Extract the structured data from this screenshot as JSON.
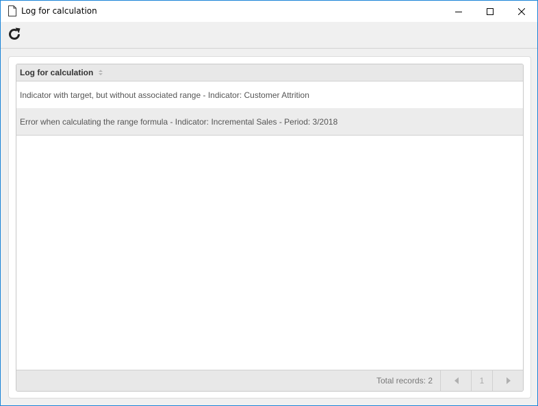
{
  "window": {
    "title": "Log for calculation"
  },
  "toolbar": {
    "refresh_icon": "refresh-icon"
  },
  "grid": {
    "column_header": "Log for calculation",
    "rows": [
      {
        "message": "Indicator with target, but without associated range - Indicator: Customer Attrition"
      },
      {
        "message": "Error when calculating the range formula - Indicator: Incremental Sales - Period: 3/2018"
      }
    ],
    "footer": {
      "total_records": "Total records: 2",
      "page": "1"
    }
  },
  "colors": {
    "accent_border": "#1883d7",
    "toolbar_bg": "#f0f0f0",
    "header_bg": "#e8e8e8",
    "alt_row_bg": "#ececec"
  }
}
